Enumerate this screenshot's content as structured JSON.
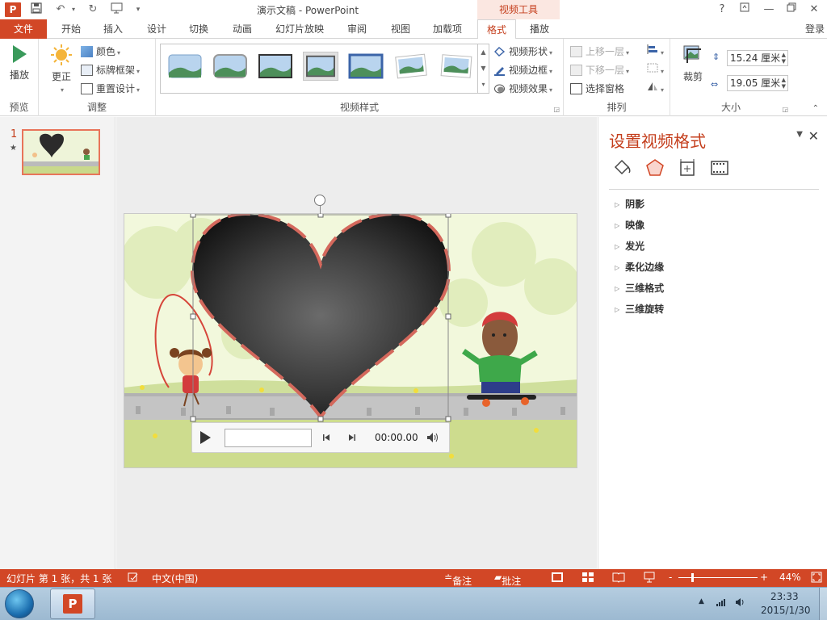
{
  "titlebar": {
    "title": "演示文稿 - PowerPoint",
    "tool_tab": "视频工具",
    "help": "?",
    "logo": "P"
  },
  "tabs": {
    "file": "文件",
    "items": [
      "开始",
      "插入",
      "设计",
      "切换",
      "动画",
      "幻灯片放映",
      "审阅",
      "视图",
      "加载项",
      "格式",
      "播放"
    ],
    "active": "格式",
    "login": "登录"
  },
  "ribbon": {
    "preview": {
      "play": "播放",
      "label": "预览"
    },
    "adjust": {
      "correct": "更正",
      "color": "颜色",
      "poster_frame": "标牌框架",
      "reset_design": "重置设计",
      "label": "调整"
    },
    "video_styles": {
      "label": "视频样式",
      "shape": "视频形状",
      "border": "视频边框",
      "effects": "视频效果"
    },
    "arrange": {
      "bring_forward": "上移一层",
      "send_backward": "下移一层",
      "selection_pane": "选择窗格",
      "label": "排列"
    },
    "size": {
      "crop": "裁剪",
      "height": "15.24 厘米",
      "width": "19.05 厘米",
      "label": "大小"
    }
  },
  "thumbnails": {
    "slide_number": "1",
    "star": "★"
  },
  "player": {
    "time": "00:00.00"
  },
  "taskpane": {
    "title": "设置视频格式",
    "sections": [
      "阴影",
      "映像",
      "发光",
      "柔化边缘",
      "三维格式",
      "三维旋转"
    ]
  },
  "statusbar": {
    "slide_info": "幻灯片 第 1 张，共 1 张",
    "language": "中文(中国)",
    "notes": "备注",
    "comments": "批注",
    "zoom": "44%",
    "zoom_minus": "-",
    "zoom_plus": "+"
  },
  "taskbar": {
    "time": "23:33",
    "date": "2015/1/30"
  },
  "colors": {
    "accent": "#d24726",
    "accent_text": "#c43e1c"
  }
}
